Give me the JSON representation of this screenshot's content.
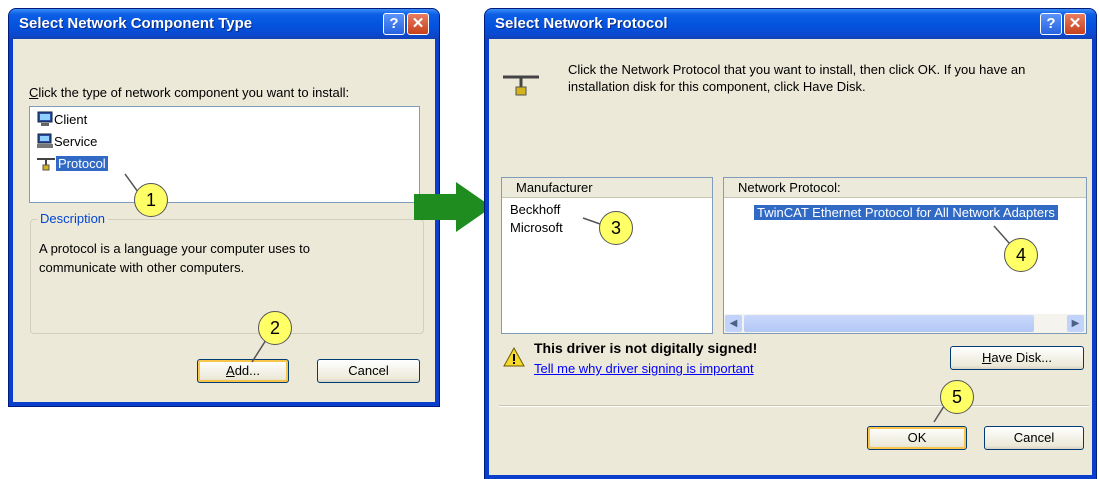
{
  "dialog1": {
    "title": "Select Network Component Type",
    "help_glyph": "?",
    "close_glyph": "✕",
    "prompt_u": "C",
    "prompt_rest": "lick the type of network component you want to install:",
    "items": [
      {
        "label": "Client",
        "icon": "client-icon"
      },
      {
        "label": "Service",
        "icon": "service-icon"
      },
      {
        "label": "Protocol",
        "icon": "protocol-icon"
      }
    ],
    "description_title": "Description",
    "description_text": "A protocol is a language your computer uses to communicate with other computers.",
    "add_button_u": "A",
    "add_button_rest": "dd...",
    "cancel_button": "Cancel"
  },
  "dialog2": {
    "title": "Select Network Protocol",
    "help_glyph": "?",
    "close_glyph": "✕",
    "intro_text": "Click the Network Protocol that you want to install, then click OK. If you have an installation disk for this component, click Have Disk.",
    "manufacturer_header": "Manufacturer",
    "manufacturers": [
      "Beckhoff",
      "Microsoft"
    ],
    "protocol_header": "Network Protocol:",
    "protocols": [
      "TwinCAT Ethernet Protocol for All Network Adapters"
    ],
    "warning_title": "This driver is not digitally signed!",
    "warning_link": "Tell me why driver signing is important",
    "have_disk_u": "H",
    "have_disk_rest": "ave Disk...",
    "ok_button": "OK",
    "cancel_button": "Cancel"
  },
  "callouts": [
    "1",
    "2",
    "3",
    "4",
    "5"
  ],
  "colors": {
    "titlebar": "#0453df",
    "selection": "#316ac5",
    "arrow": "#1f8c1f",
    "callout": "#ffff66"
  }
}
